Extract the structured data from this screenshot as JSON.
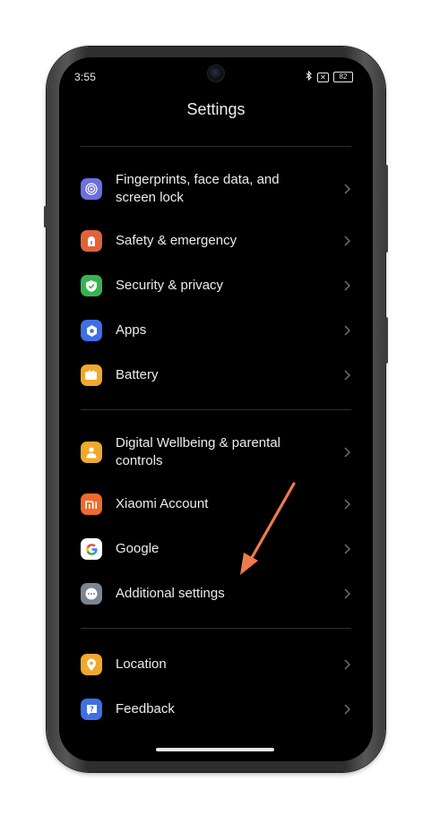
{
  "status_bar": {
    "time": "3:55",
    "battery": "82"
  },
  "page": {
    "title": "Settings"
  },
  "sections": [
    {
      "items": [
        {
          "label": "Fingerprints, face data, and screen lock",
          "icon": "fingerprint-icon",
          "color": "#6b6fe0"
        },
        {
          "label": "Safety & emergency",
          "icon": "emergency-icon",
          "color": "#e0623a"
        },
        {
          "label": "Security & privacy",
          "icon": "shield-check-icon",
          "color": "#35b552"
        },
        {
          "label": "Apps",
          "icon": "apps-icon",
          "color": "#3f6fe6"
        },
        {
          "label": "Battery",
          "icon": "battery-icon",
          "color": "#f0a92b"
        }
      ]
    },
    {
      "items": [
        {
          "label": "Digital Wellbeing & parental controls",
          "icon": "wellbeing-icon",
          "color": "#f0a92b"
        },
        {
          "label": "Xiaomi Account",
          "icon": "xiaomi-icon",
          "color": "#ef6a2c"
        },
        {
          "label": "Google",
          "icon": "google-icon",
          "color": "#ffffff"
        },
        {
          "label": "Additional settings",
          "icon": "more-dots-icon",
          "color": "#7c8594"
        }
      ]
    },
    {
      "items": [
        {
          "label": "Location",
          "icon": "location-pin-icon",
          "color": "#f0a92b"
        },
        {
          "label": "Feedback",
          "icon": "feedback-icon",
          "color": "#3f6fe6"
        }
      ]
    }
  ],
  "annotation": {
    "arrow_color": "#f07a4e"
  }
}
